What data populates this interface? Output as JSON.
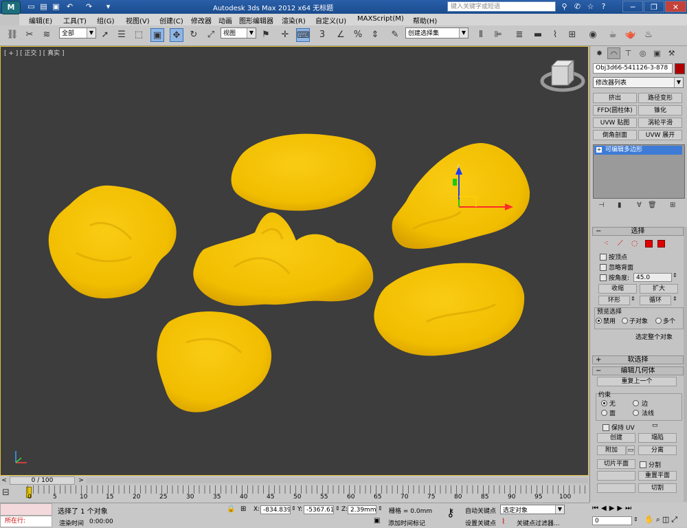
{
  "title_bar": {
    "title": "Autodesk 3ds Max  2012 x64      无标题",
    "search_placeholder": "键入关键字或短语"
  },
  "menu": {
    "items": [
      "编辑(E)",
      "工具(T)",
      "组(G)",
      "视图(V)",
      "创建(C)",
      "修改器",
      "动画",
      "图形编辑器",
      "渲染(R)",
      "自定义(U)",
      "MAXScript(M)",
      "帮助(H)"
    ]
  },
  "toolbar": {
    "filter_select": "全部",
    "ref_coord": "视图",
    "snap_label": "3",
    "named_selection": "创建选择集"
  },
  "viewport": {
    "label": "[ + ] [ 正交 ] [ 真实 ]",
    "object_color": "#f5c400",
    "gizmo_z_label": "z"
  },
  "command_panel": {
    "object_name": "Obj3d66-541126-3-878",
    "object_color": "#b00000",
    "modifier_list": "修改器列表",
    "modifier_buttons": [
      [
        "挤出",
        "路径变形"
      ],
      [
        "FFD(圆柱体)",
        "锥化"
      ],
      [
        "UVW 贴图",
        "涡轮平滑"
      ],
      [
        "倒角剖面",
        "UVW 展开"
      ]
    ],
    "stack_item": "可编辑多边形",
    "selection": {
      "header": "选择",
      "by_vertex": "按顶点",
      "ignore_backface": "忽略背面",
      "by_angle": "按角度:",
      "angle_value": "45.0",
      "shrink": "收缩",
      "grow": "扩大",
      "ring": "环形",
      "loop": "循环",
      "preview_label": "预览选择",
      "preview_disabled": "禁用",
      "preview_subobject": "子对象",
      "preview_multi": "多个",
      "select_whole": "选定整个对象"
    },
    "soft_selection": "软选择",
    "edit_geometry": {
      "header": "编辑几何体",
      "repeat_last": "重复上一个",
      "constraints_label": "约束",
      "none": "无",
      "edge": "边",
      "face": "面",
      "normal": "法线",
      "preserve_uv": "保持 UV",
      "create": "创建",
      "collapse": "塌陷",
      "attach": "附加",
      "detach": "分离",
      "slice_plane": "切片平面",
      "split": "分割",
      "reset_plane": "重置平面",
      "cut": "切割"
    }
  },
  "timeline": {
    "frame_display": "0 / 100",
    "ticks": [
      "0",
      "5",
      "10",
      "15",
      "20",
      "25",
      "30",
      "35",
      "40",
      "45",
      "50",
      "55",
      "60",
      "65",
      "70",
      "75",
      "80",
      "85",
      "90",
      "95",
      "100"
    ]
  },
  "status": {
    "mode_label": "所在行:",
    "selection_msg": "选择了 1 个对象",
    "render_time_label": "渲染时间",
    "render_time": "0:00:00",
    "x_label": "X:",
    "x_value": "-834.839m",
    "y_label": "Y:",
    "y_value": "-5367.61m",
    "z_label": "Z:",
    "z_value": "2.39mm",
    "grid": "栅格 = 0.0mm",
    "add_time_tag": "添加时间标记",
    "auto_key": "自动关键点",
    "set_key": "设置关键点",
    "key_mode": "选定对象",
    "key_filters": "关键点过滤器...",
    "frame_value": "0"
  }
}
